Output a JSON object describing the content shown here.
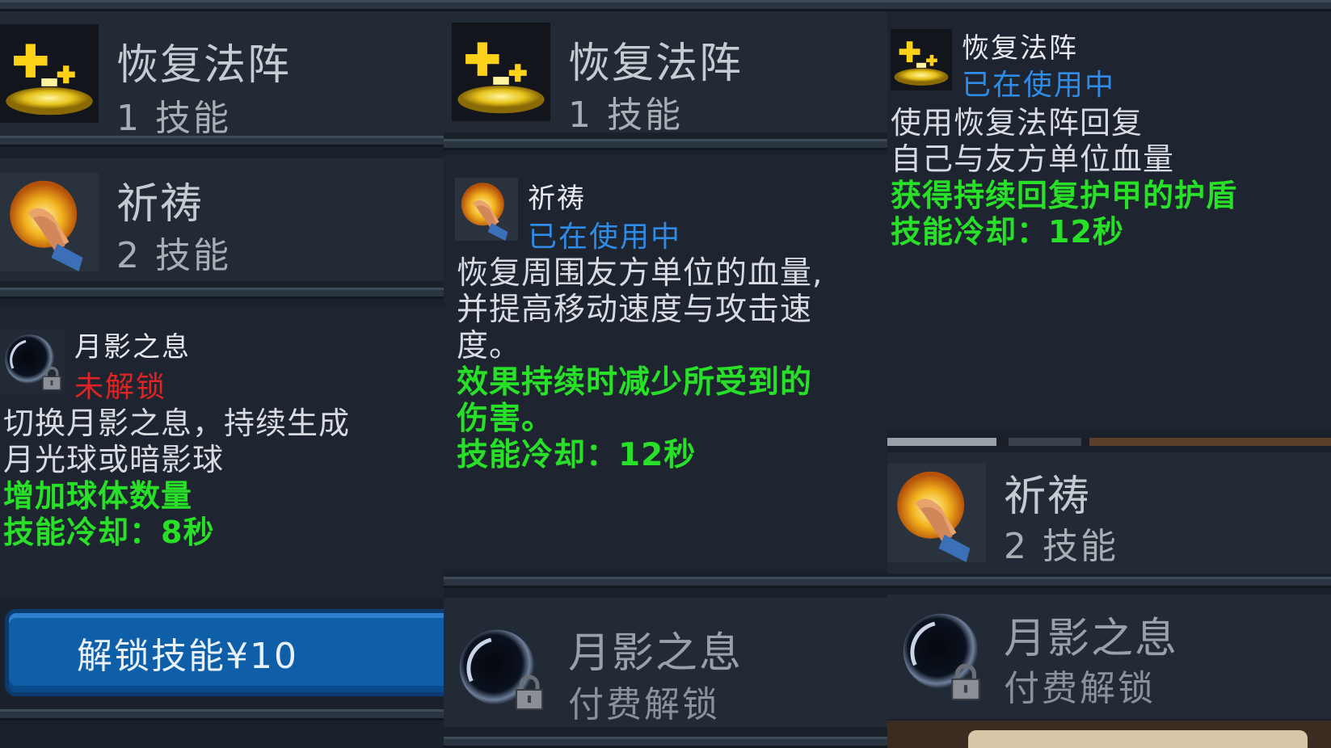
{
  "panels": [
    {
      "skill1": {
        "name": "恢复法阵",
        "sub": "1 技能"
      },
      "skill2": {
        "name": "祈祷",
        "sub": "2 技能"
      },
      "skill3": {
        "name": "月影之息",
        "status": "未解锁",
        "desc_lines": [
          "切换月影之息，持续生成",
          "月光球或暗影球"
        ],
        "green_lines": [
          "增加球体数量",
          "技能冷却：8秒"
        ]
      },
      "unlock_button": "解锁技能¥10"
    },
    {
      "skill1": {
        "name": "恢复法阵",
        "sub": "1 技能"
      },
      "skill2": {
        "name": "祈祷",
        "status": "已在使用中",
        "desc_lines": [
          "恢复周围友方单位的血量,",
          "并提高移动速度与攻击速",
          "度。"
        ],
        "green_lines": [
          "效果持续时减少所受到的",
          "伤害。",
          "技能冷却：12秒"
        ]
      },
      "skill3": {
        "name": "月影之息",
        "sub": "付费解锁"
      }
    },
    {
      "skill1": {
        "name": "恢复法阵",
        "status": "已在使用中",
        "desc_lines": [
          "使用恢复法阵回复",
          "自己与友方单位血量"
        ],
        "green_lines": [
          "获得持续回复护甲的护盾",
          "技能冷却：12秒"
        ]
      },
      "skill2": {
        "name": "祈祷",
        "sub": "2 技能"
      },
      "skill3": {
        "name": "月影之息",
        "sub": "付费解锁"
      }
    }
  ],
  "icons": {
    "skill1": "healing-circle-icon",
    "skill2": "prayer-hand-icon",
    "skill3": "moon-shadow-icon",
    "lock": "lock-icon"
  },
  "colors": {
    "status_active": "#2f8be6",
    "status_locked": "#e02424",
    "effect_text": "#27e027",
    "unlock_button": "#0f5ea8"
  }
}
